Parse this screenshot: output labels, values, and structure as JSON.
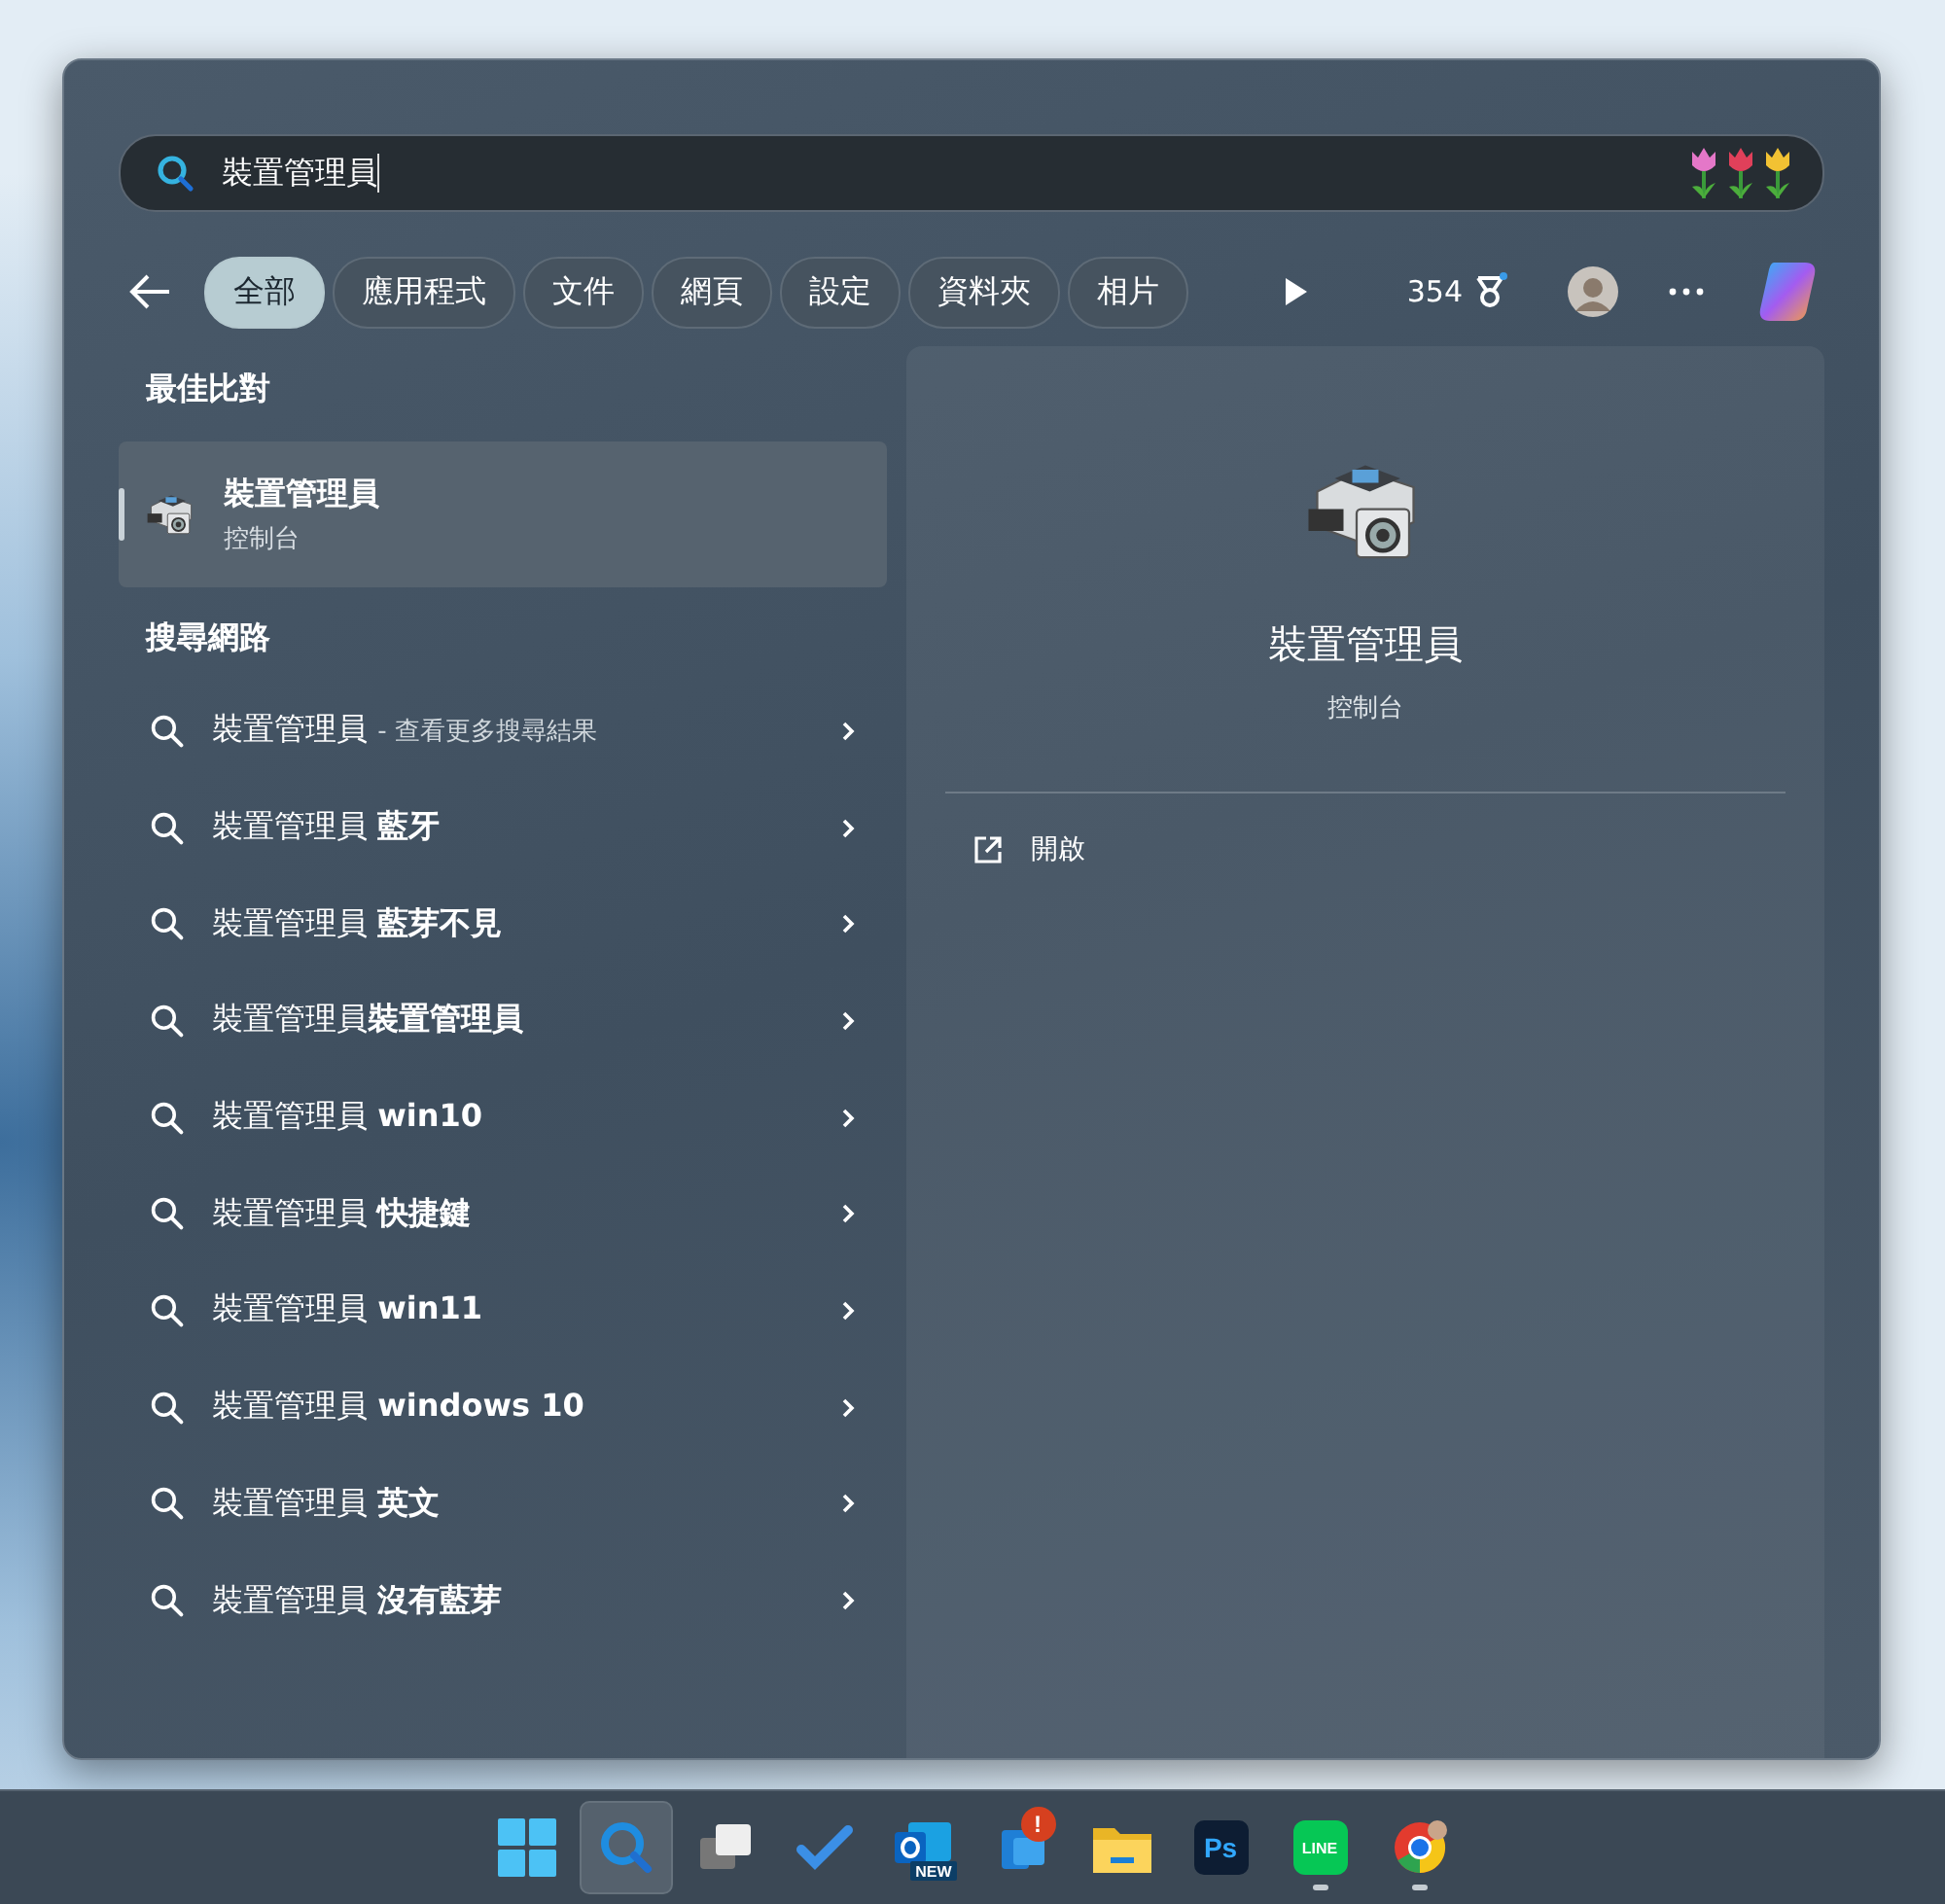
{
  "search": {
    "value": "裝置管理員"
  },
  "filters": [
    {
      "label": "全部",
      "selected": true
    },
    {
      "label": "應用程式",
      "selected": false
    },
    {
      "label": "文件",
      "selected": false
    },
    {
      "label": "網頁",
      "selected": false
    },
    {
      "label": "設定",
      "selected": false
    },
    {
      "label": "資料夾",
      "selected": false
    },
    {
      "label": "相片",
      "selected": false
    }
  ],
  "points": "354",
  "best_match": {
    "heading": "最佳比對",
    "title": "裝置管理員",
    "subtitle": "控制台",
    "selected": true
  },
  "web": {
    "heading": "搜尋網路",
    "items": [
      {
        "kind": "more",
        "label": "裝置管理員",
        "hint": "- 查看更多搜尋結果"
      },
      {
        "kind": "suggestion",
        "label": "裝置管理員 **藍牙**"
      },
      {
        "kind": "suggestion",
        "label": "裝置管理員 **藍芽不見**"
      },
      {
        "kind": "suggestion",
        "label": "裝置管理員**裝置管理員**"
      },
      {
        "kind": "suggestion",
        "label": "裝置管理員 **win10**"
      },
      {
        "kind": "suggestion",
        "label": "裝置管理員 **快捷鍵**"
      },
      {
        "kind": "suggestion",
        "label": "裝置管理員 **win11**"
      },
      {
        "kind": "suggestion",
        "label": "裝置管理員 **windows 10**"
      },
      {
        "kind": "suggestion",
        "label": "裝置管理員 **英文**"
      },
      {
        "kind": "suggestion",
        "label": "裝置管理員 **沒有藍芽**"
      }
    ]
  },
  "preview": {
    "title": "裝置管理員",
    "subtitle": "控制台",
    "actions": [
      {
        "label": "開啟"
      }
    ]
  },
  "taskbar": [
    {
      "kind": "start",
      "selected": false,
      "running": false
    },
    {
      "kind": "search",
      "selected": true,
      "running": false
    },
    {
      "kind": "taskview",
      "selected": false,
      "running": false
    },
    {
      "kind": "todo",
      "selected": false,
      "running": false
    },
    {
      "kind": "outlook",
      "selected": false,
      "running": false,
      "tag": "NEW"
    },
    {
      "kind": "phone",
      "selected": false,
      "running": false,
      "badge": "!"
    },
    {
      "kind": "folder",
      "selected": false,
      "running": false
    },
    {
      "kind": "ps",
      "selected": false,
      "running": false,
      "tag": "Ps"
    },
    {
      "kind": "line",
      "selected": false,
      "running": true,
      "tag": "LINE"
    },
    {
      "kind": "chrome",
      "selected": false,
      "running": true
    }
  ]
}
